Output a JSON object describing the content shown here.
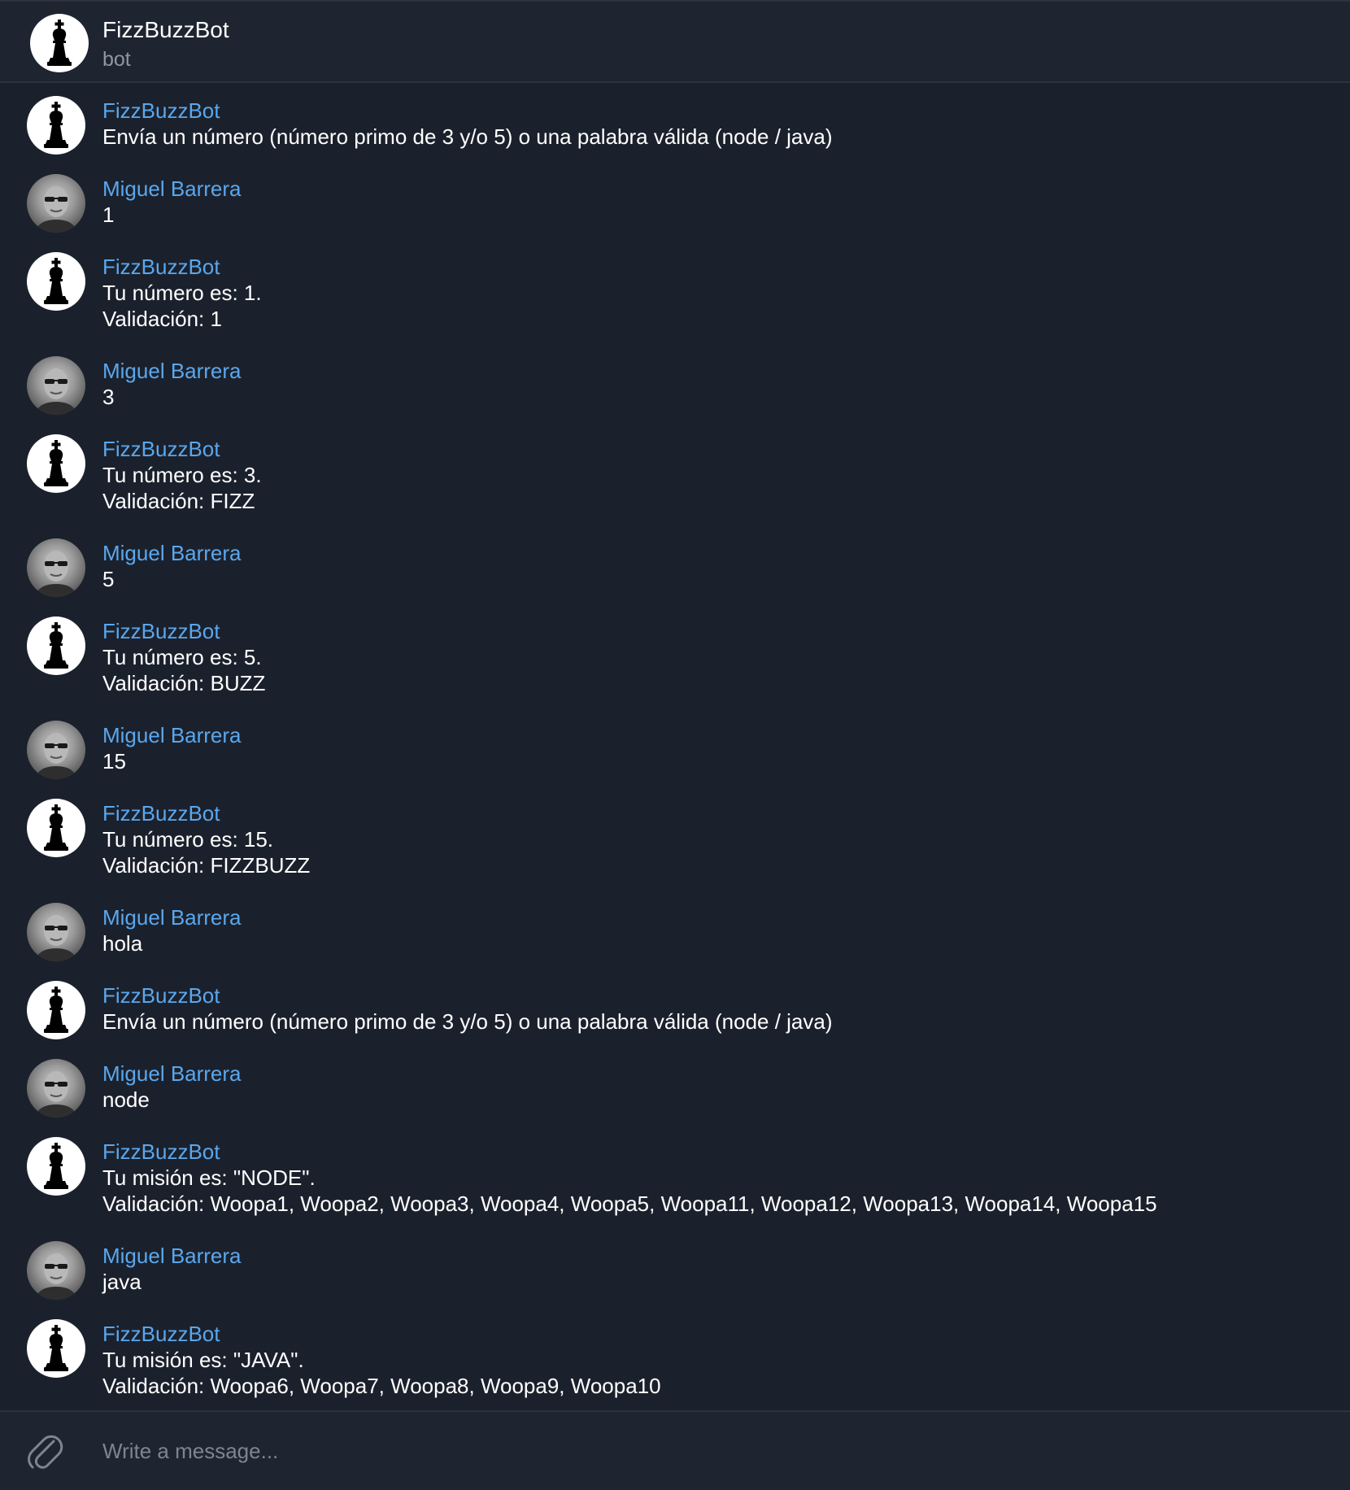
{
  "header": {
    "title": "FizzBuzzBot",
    "subtitle": "bot",
    "avatar_icon": "chess-king-icon"
  },
  "messages": [
    {
      "sender": "FizzBuzzBot",
      "type": "bot",
      "lines": [
        "Envía un número (número primo de 3 y/o 5) o una palabra válida (node / java)"
      ]
    },
    {
      "sender": "Miguel Barrera",
      "type": "user",
      "lines": [
        "1"
      ]
    },
    {
      "sender": "FizzBuzzBot",
      "type": "bot",
      "lines": [
        "Tu número es: 1.",
        "Validación: 1"
      ]
    },
    {
      "sender": "Miguel Barrera",
      "type": "user",
      "lines": [
        "3"
      ]
    },
    {
      "sender": "FizzBuzzBot",
      "type": "bot",
      "lines": [
        "Tu número es: 3.",
        "Validación: FIZZ"
      ]
    },
    {
      "sender": "Miguel Barrera",
      "type": "user",
      "lines": [
        "5"
      ]
    },
    {
      "sender": "FizzBuzzBot",
      "type": "bot",
      "lines": [
        "Tu número es: 5.",
        "Validación: BUZZ"
      ]
    },
    {
      "sender": "Miguel Barrera",
      "type": "user",
      "lines": [
        "15"
      ]
    },
    {
      "sender": "FizzBuzzBot",
      "type": "bot",
      "lines": [
        "Tu número es: 15.",
        "Validación: FIZZBUZZ"
      ]
    },
    {
      "sender": "Miguel Barrera",
      "type": "user",
      "lines": [
        "hola"
      ]
    },
    {
      "sender": "FizzBuzzBot",
      "type": "bot",
      "lines": [
        "Envía un número (número primo de 3 y/o 5) o una palabra válida (node / java)"
      ]
    },
    {
      "sender": "Miguel Barrera",
      "type": "user",
      "lines": [
        "node"
      ]
    },
    {
      "sender": "FizzBuzzBot",
      "type": "bot",
      "lines": [
        "Tu misión es: \"NODE\".",
        "Validación: Woopa1, Woopa2, Woopa3, Woopa4, Woopa5, Woopa11, Woopa12, Woopa13, Woopa14, Woopa15"
      ]
    },
    {
      "sender": "Miguel Barrera",
      "type": "user",
      "lines": [
        "java"
      ]
    },
    {
      "sender": "FizzBuzzBot",
      "type": "bot",
      "lines": [
        "Tu misión es: \"JAVA\".",
        "Validación: Woopa6, Woopa7, Woopa8, Woopa9, Woopa10"
      ]
    }
  ],
  "composer": {
    "placeholder": "Write a message...",
    "value": "",
    "attach_icon": "paperclip-icon"
  },
  "colors": {
    "background": "#1b212c",
    "panel": "#1e2530",
    "sender_name": "#5aa7ee",
    "text": "#ffffff",
    "muted": "#8d97a4"
  }
}
